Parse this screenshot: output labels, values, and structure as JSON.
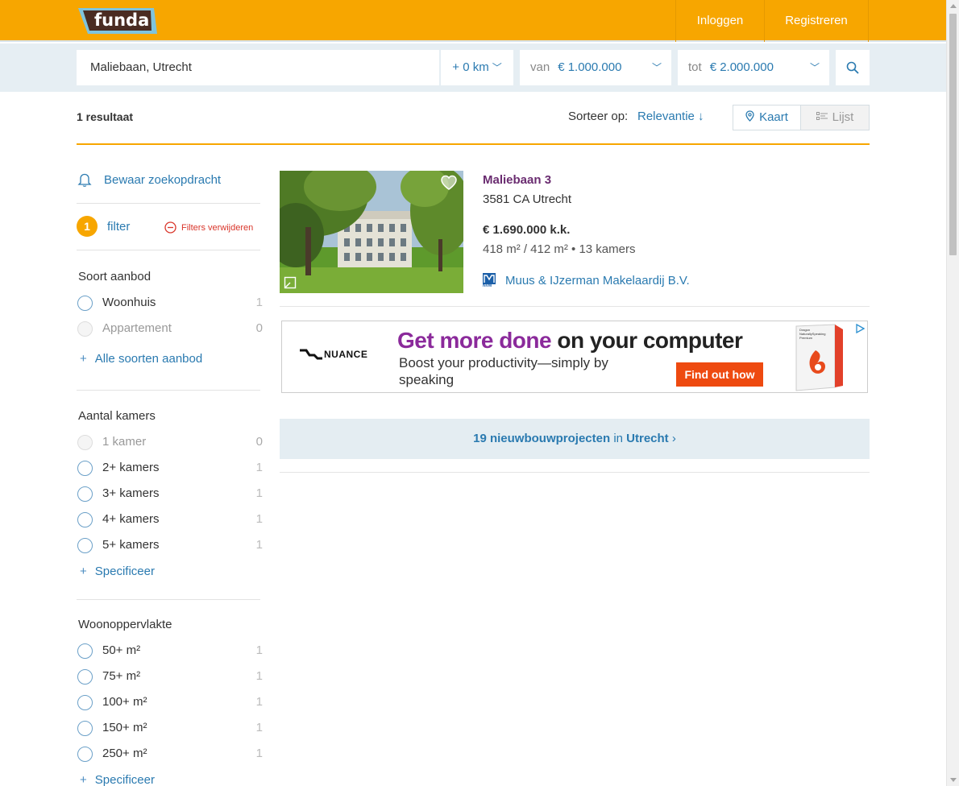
{
  "header": {
    "logo_text": "funda",
    "login_label": "Inloggen",
    "register_label": "Registreren",
    "brand_color": "#f7a600"
  },
  "search": {
    "location": "Maliebaan, Utrecht",
    "radius": "+ 0 km",
    "min_prefix": "van",
    "min_value": "€ 1.000.000",
    "max_prefix": "tot",
    "max_value": "€ 2.000.000"
  },
  "results": {
    "count_label": "1 resultaat",
    "sort_label": "Sorteer op:",
    "sort_value": "Relevantie ↓",
    "view_map": "Kaart",
    "view_list": "Lijst"
  },
  "sidebar": {
    "save_search": "Bewaar zoekopdracht",
    "filter_count": "1",
    "filter_label": "filter",
    "filters_remove": "Filters verwijderen",
    "groups": [
      {
        "title": "Soort aanbod",
        "options": [
          {
            "label": "Woonhuis",
            "count": "1"
          },
          {
            "label": "Appartement",
            "count": "0"
          }
        ],
        "more": "Alle soorten aanbod"
      },
      {
        "title": "Aantal kamers",
        "options": [
          {
            "label": "1 kamer",
            "count": "0"
          },
          {
            "label": "2+ kamers",
            "count": "1"
          },
          {
            "label": "3+ kamers",
            "count": "1"
          },
          {
            "label": "4+ kamers",
            "count": "1"
          },
          {
            "label": "5+ kamers",
            "count": "1"
          }
        ],
        "more": "Specificeer"
      },
      {
        "title": "Woonoppervlakte",
        "options": [
          {
            "label": "50+ m²",
            "count": "1"
          },
          {
            "label": "75+ m²",
            "count": "1"
          },
          {
            "label": "100+ m²",
            "count": "1"
          },
          {
            "label": "150+ m²",
            "count": "1"
          },
          {
            "label": "250+ m²",
            "count": "1"
          }
        ],
        "more": "Specificeer"
      }
    ]
  },
  "listing": {
    "title": "Maliebaan 3",
    "zip_city": "3581 CA Utrecht",
    "price": "€ 1.690.000 k.k.",
    "specs": "418 m² / 412 m² • 13 kamers",
    "agent": "Muus & IJzerman Makelaardij B.V.",
    "agent_logo_text": "NVM"
  },
  "ad": {
    "brand": "NUANCE",
    "headline_highlight": "Get more done",
    "headline_rest": " on your computer",
    "subline": "Boost your productivity—simply by speaking",
    "cta": "Find out how",
    "product_text": "Dragon NaturallySpeaking Premium"
  },
  "newbuild": {
    "count_text": "19 nieuwbouwprojecten",
    "in_text": " in ",
    "city": "Utrecht",
    "arrow": "›"
  }
}
